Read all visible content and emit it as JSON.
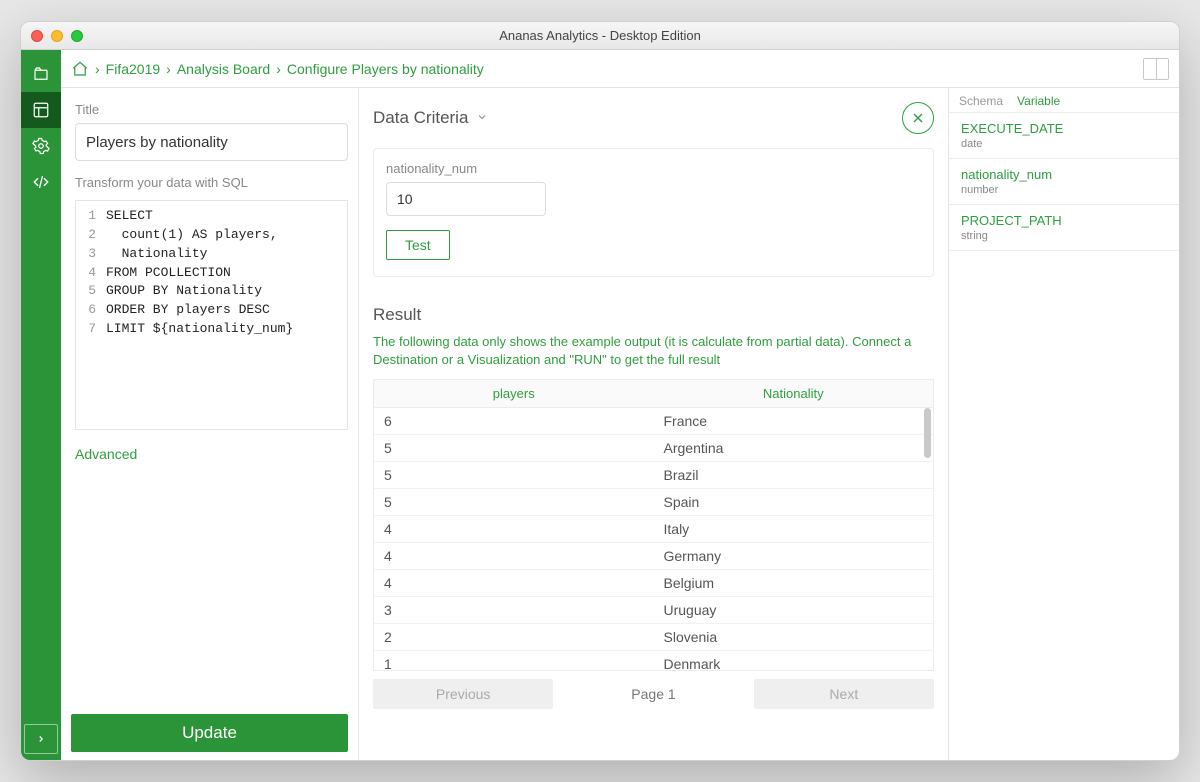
{
  "window": {
    "title": "Ananas Analytics - Desktop Edition"
  },
  "breadcrumb": {
    "items": [
      "Fifa2019",
      "Analysis Board",
      "Configure Players by nationality"
    ]
  },
  "left": {
    "title_label": "Title",
    "title_value": "Players by nationality",
    "transform_label": "Transform your data with SQL",
    "sql_lines": [
      "SELECT",
      "  count(1) AS players,",
      "  Nationality",
      "FROM PCOLLECTION",
      "GROUP BY Nationality",
      "ORDER BY players DESC",
      "LIMIT ${nationality_num}"
    ],
    "advanced_label": "Advanced",
    "update_label": "Update"
  },
  "middle": {
    "criteria_label": "Data Criteria",
    "param_name": "nationality_num",
    "param_value": "10",
    "test_label": "Test",
    "result_label": "Result",
    "result_note": "The following data only shows the example output (it is calculate from partial data). Connect a Destination or a Visualization and \"RUN\" to get the full result",
    "columns": [
      "players",
      "Nationality"
    ],
    "rows": [
      [
        "6",
        "France"
      ],
      [
        "5",
        "Argentina"
      ],
      [
        "5",
        "Brazil"
      ],
      [
        "5",
        "Spain"
      ],
      [
        "4",
        "Italy"
      ],
      [
        "4",
        "Germany"
      ],
      [
        "4",
        "Belgium"
      ],
      [
        "3",
        "Uruguay"
      ],
      [
        "2",
        "Slovenia"
      ],
      [
        "1",
        "Denmark"
      ]
    ],
    "prev_label": "Previous",
    "page_label": "Page 1",
    "next_label": "Next"
  },
  "right": {
    "tabs": {
      "schema": "Schema",
      "variable": "Variable"
    },
    "active_tab": "Variable",
    "variables": [
      {
        "name": "EXECUTE_DATE",
        "type": "date"
      },
      {
        "name": "nationality_num",
        "type": "number"
      },
      {
        "name": "PROJECT_PATH",
        "type": "string"
      }
    ]
  }
}
